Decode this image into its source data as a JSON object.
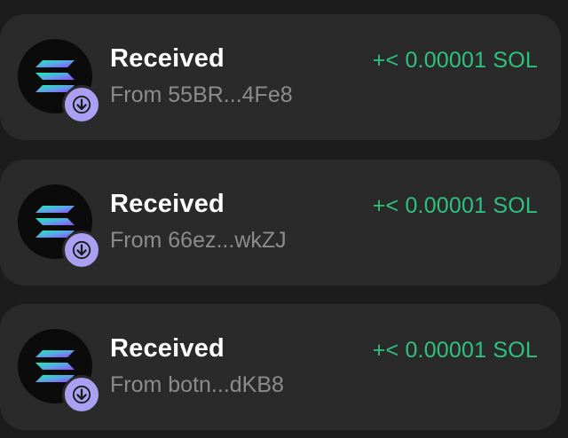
{
  "colors": {
    "background": "#1c1c1c",
    "card": "#2a2a2a",
    "amount": "#2ec27e",
    "badge": "#ab9ff2",
    "subtitle": "#8c8c8c"
  },
  "transactions": [
    {
      "title": "Received",
      "subtitle": "From 55BR...4Fe8",
      "amount": "+< 0.00001 SOL",
      "token_icon": "solana-logo-icon",
      "badge_icon": "arrow-down-icon"
    },
    {
      "title": "Received",
      "subtitle": "From 66ez...wkZJ",
      "amount": "+< 0.00001 SOL",
      "token_icon": "solana-logo-icon",
      "badge_icon": "arrow-down-icon"
    },
    {
      "title": "Received",
      "subtitle": "From botn...dKB8",
      "amount": "+< 0.00001 SOL",
      "token_icon": "solana-logo-icon",
      "badge_icon": "arrow-down-icon"
    }
  ]
}
